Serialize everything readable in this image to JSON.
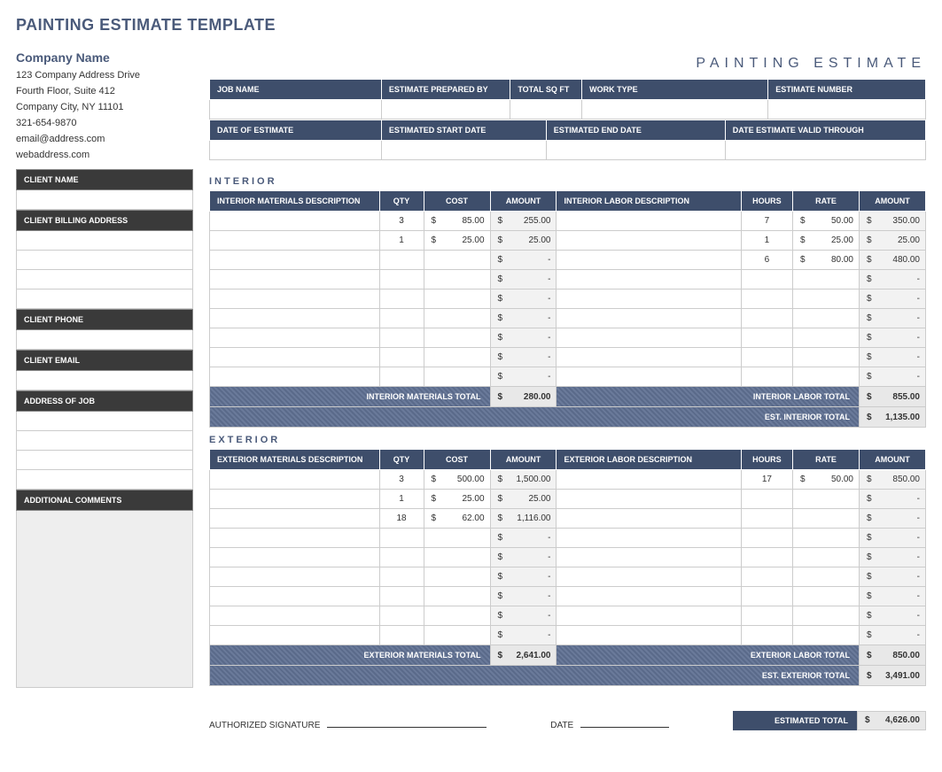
{
  "title": "PAINTING ESTIMATE TEMPLATE",
  "doc_title": "PAINTING  ESTIMATE",
  "company": {
    "name": "Company Name",
    "addr1": "123 Company Address Drive",
    "addr2": "Fourth Floor, Suite 412",
    "city": "Company City, NY  11101",
    "phone": "321-654-9870",
    "email": "email@address.com",
    "web": "webaddress.com"
  },
  "left_labels": {
    "client_name": "CLIENT NAME",
    "client_billing": "CLIENT BILLING ADDRESS",
    "client_phone": "CLIENT PHONE",
    "client_email": "CLIENT EMAIL",
    "job_addr": "ADDRESS OF JOB",
    "comments": "ADDITIONAL COMMENTS"
  },
  "meta_headers": {
    "job_name": "JOB NAME",
    "prepared_by": "ESTIMATE PREPARED BY",
    "total_sqft": "TOTAL SQ FT",
    "work_type": "WORK TYPE",
    "estimate_number": "ESTIMATE NUMBER",
    "date_of_estimate": "DATE OF ESTIMATE",
    "est_start": "ESTIMATED START DATE",
    "est_end": "ESTIMATED END DATE",
    "valid_through": "DATE ESTIMATE VALID THROUGH"
  },
  "sections": {
    "interior": "INTERIOR",
    "exterior": "EXTERIOR"
  },
  "table_headers": {
    "mat_desc_int": "INTERIOR MATERIALS DESCRIPTION",
    "mat_desc_ext": "EXTERIOR MATERIALS DESCRIPTION",
    "qty": "QTY",
    "cost": "COST",
    "amount": "AMOUNT",
    "lab_desc_int": "INTERIOR LABOR DESCRIPTION",
    "lab_desc_ext": "EXTERIOR LABOR DESCRIPTION",
    "hours": "HOURS",
    "rate": "RATE"
  },
  "interior": {
    "materials": [
      {
        "qty": "3",
        "cost": "85.00",
        "amount": "255.00"
      },
      {
        "qty": "1",
        "cost": "25.00",
        "amount": "25.00"
      },
      {
        "qty": "",
        "cost": "",
        "amount": "-"
      },
      {
        "qty": "",
        "cost": "",
        "amount": "-"
      },
      {
        "qty": "",
        "cost": "",
        "amount": "-"
      },
      {
        "qty": "",
        "cost": "",
        "amount": "-"
      },
      {
        "qty": "",
        "cost": "",
        "amount": "-"
      },
      {
        "qty": "",
        "cost": "",
        "amount": "-"
      },
      {
        "qty": "",
        "cost": "",
        "amount": "-"
      }
    ],
    "labor": [
      {
        "hours": "7",
        "rate": "50.00",
        "amount": "350.00"
      },
      {
        "hours": "1",
        "rate": "25.00",
        "amount": "25.00"
      },
      {
        "hours": "6",
        "rate": "80.00",
        "amount": "480.00"
      },
      {
        "hours": "",
        "rate": "",
        "amount": "-"
      },
      {
        "hours": "",
        "rate": "",
        "amount": "-"
      },
      {
        "hours": "",
        "rate": "",
        "amount": "-"
      },
      {
        "hours": "",
        "rate": "",
        "amount": "-"
      },
      {
        "hours": "",
        "rate": "",
        "amount": "-"
      },
      {
        "hours": "",
        "rate": "",
        "amount": "-"
      }
    ],
    "mat_total_label": "INTERIOR MATERIALS TOTAL",
    "mat_total": "280.00",
    "lab_total_label": "INTERIOR LABOR TOTAL",
    "lab_total": "855.00",
    "est_total_label": "EST. INTERIOR  TOTAL",
    "est_total": "1,135.00"
  },
  "exterior": {
    "materials": [
      {
        "qty": "3",
        "cost": "500.00",
        "amount": "1,500.00"
      },
      {
        "qty": "1",
        "cost": "25.00",
        "amount": "25.00"
      },
      {
        "qty": "18",
        "cost": "62.00",
        "amount": "1,116.00"
      },
      {
        "qty": "",
        "cost": "",
        "amount": "-"
      },
      {
        "qty": "",
        "cost": "",
        "amount": "-"
      },
      {
        "qty": "",
        "cost": "",
        "amount": "-"
      },
      {
        "qty": "",
        "cost": "",
        "amount": "-"
      },
      {
        "qty": "",
        "cost": "",
        "amount": "-"
      },
      {
        "qty": "",
        "cost": "",
        "amount": "-"
      }
    ],
    "labor": [
      {
        "hours": "17",
        "rate": "50.00",
        "amount": "850.00"
      },
      {
        "hours": "",
        "rate": "",
        "amount": "-"
      },
      {
        "hours": "",
        "rate": "",
        "amount": "-"
      },
      {
        "hours": "",
        "rate": "",
        "amount": "-"
      },
      {
        "hours": "",
        "rate": "",
        "amount": "-"
      },
      {
        "hours": "",
        "rate": "",
        "amount": "-"
      },
      {
        "hours": "",
        "rate": "",
        "amount": "-"
      },
      {
        "hours": "",
        "rate": "",
        "amount": "-"
      },
      {
        "hours": "",
        "rate": "",
        "amount": "-"
      }
    ],
    "mat_total_label": "EXTERIOR MATERIALS TOTAL",
    "mat_total": "2,641.00",
    "lab_total_label": "EXTERIOR LABOR TOTAL",
    "lab_total": "850.00",
    "est_total_label": "EST. EXTERIOR  TOTAL",
    "est_total": "3,491.00"
  },
  "footer": {
    "sig": "AUTHORIZED SIGNATURE",
    "date": "DATE",
    "estimated_total_label": "ESTIMATED TOTAL",
    "estimated_total": "4,626.00"
  }
}
